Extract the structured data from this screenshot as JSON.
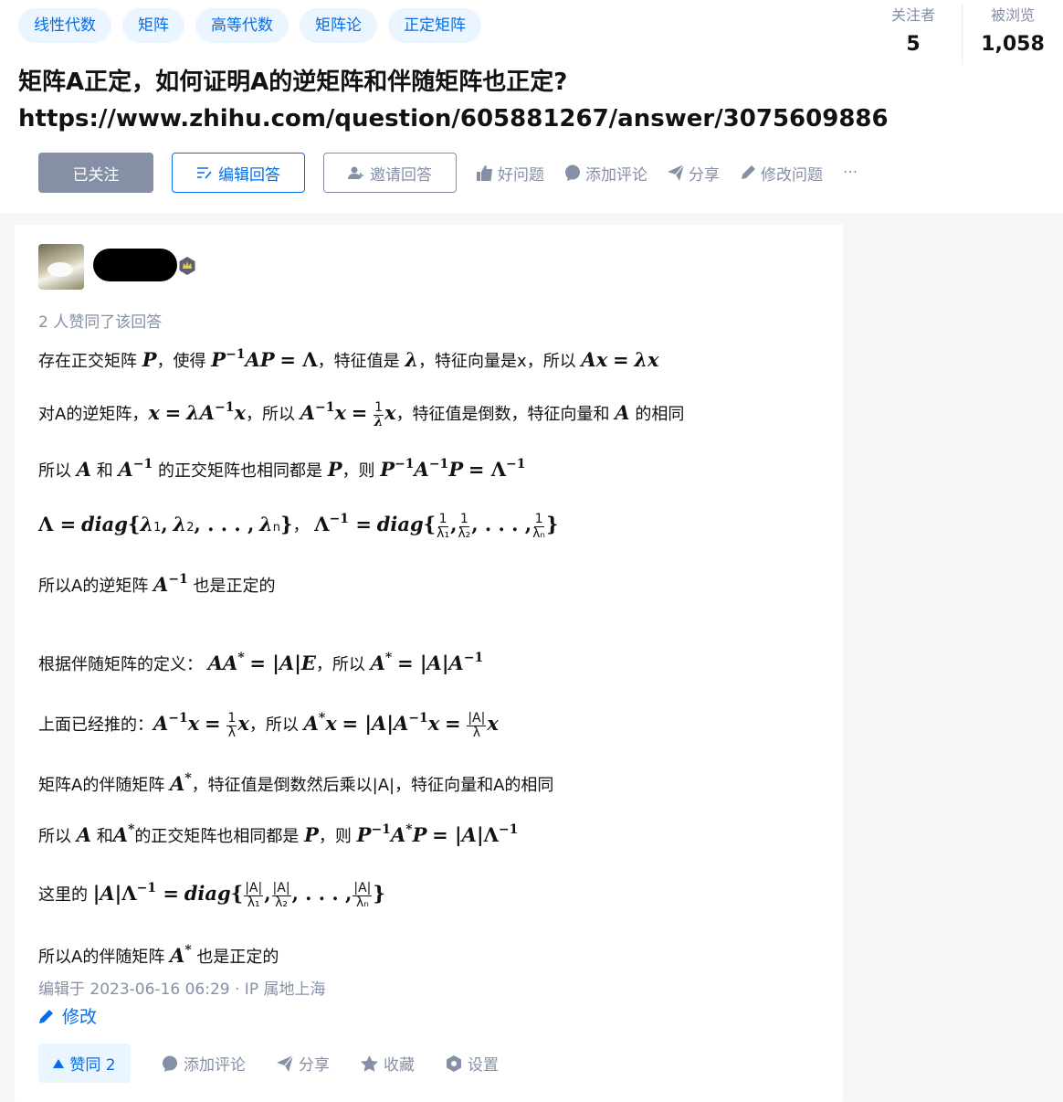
{
  "header": {
    "tags": [
      "线性代数",
      "矩阵",
      "高等代数",
      "矩阵论",
      "正定矩阵"
    ],
    "stats": [
      {
        "label": "关注者",
        "value": "5"
      },
      {
        "label": "被浏览",
        "value": "1,058"
      }
    ],
    "title_line1": "矩阵A正定，如何证明A的逆矩阵和伴随矩阵也正定?",
    "title_line2": "https://www.zhihu.com/question/605881267/answer/3075609886",
    "actions": {
      "follow": "已关注",
      "edit_answer": "编辑回答",
      "invite": "邀请回答",
      "good_question": "好问题",
      "add_comment": "添加评论",
      "share": "分享",
      "modify_question": "修改问题",
      "more": "···"
    }
  },
  "answer": {
    "upvoters": "2 人赞同了该回答",
    "edit_info": "编辑于 2023-06-16 06:29 · IP 属地上海",
    "modify": "修改",
    "footer": {
      "vote": "赞同 2",
      "comment": "添加评论",
      "share": "分享",
      "collect": "收藏",
      "settings": "设置"
    }
  },
  "colors": {
    "accent": "#056de8",
    "muted": "#8590a6",
    "tag_bg": "#ebf5ff",
    "follow_bg": "#8590a6"
  }
}
